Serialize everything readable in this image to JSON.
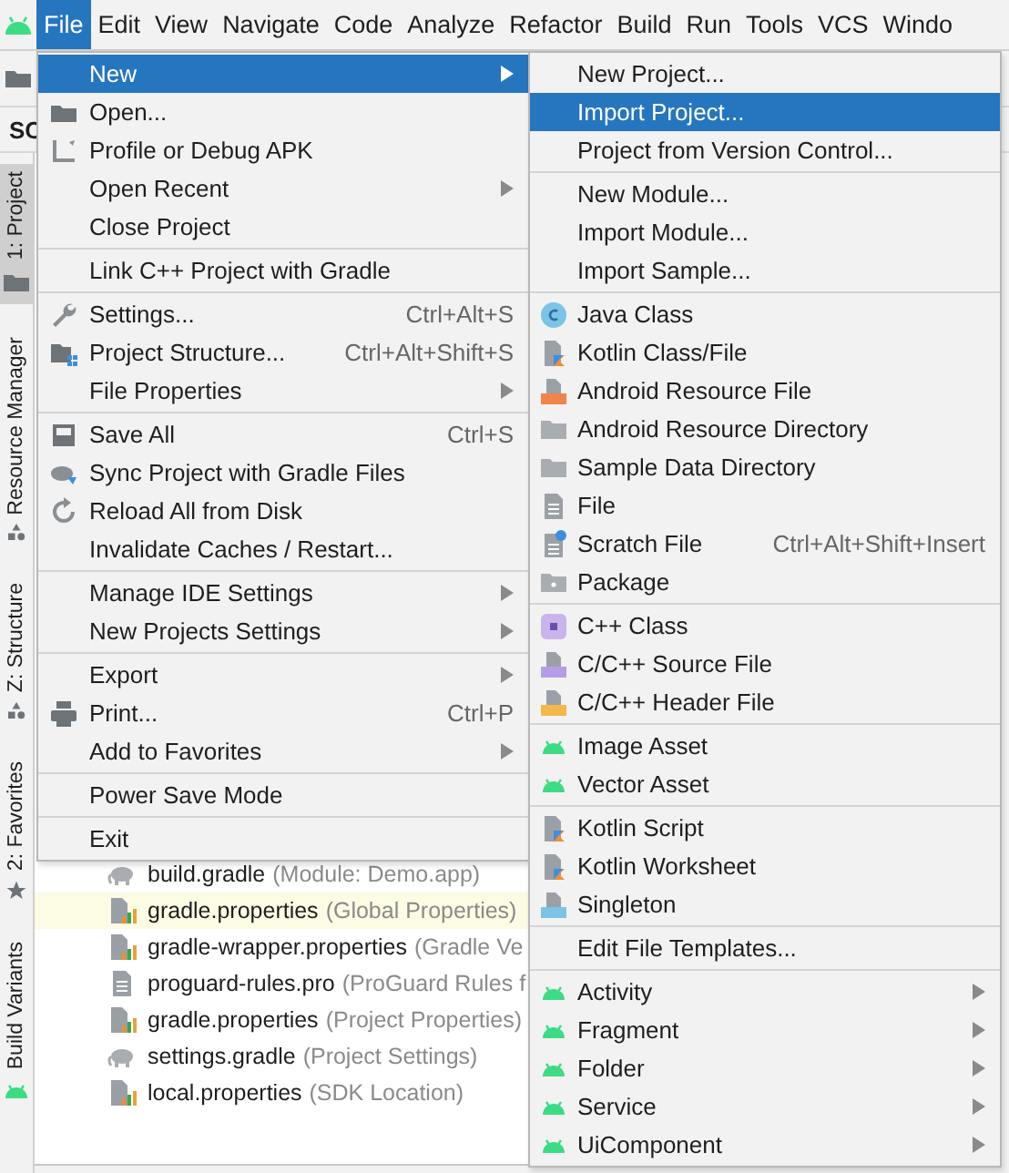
{
  "menubar": {
    "items": [
      {
        "label": "File",
        "selected": true
      },
      {
        "label": "Edit",
        "selected": false
      },
      {
        "label": "View",
        "selected": false
      },
      {
        "label": "Navigate",
        "selected": false
      },
      {
        "label": "Code",
        "selected": false
      },
      {
        "label": "Analyze",
        "selected": false
      },
      {
        "label": "Refactor",
        "selected": false
      },
      {
        "label": "Build",
        "selected": false
      },
      {
        "label": "Run",
        "selected": false
      },
      {
        "label": "Tools",
        "selected": false
      },
      {
        "label": "VCS",
        "selected": false
      },
      {
        "label": "Windo",
        "selected": false
      }
    ]
  },
  "editor_tab": {
    "label": "SC"
  },
  "tool_strip": [
    {
      "label": "1: Project",
      "selected": true
    },
    {
      "label": "Resource Manager",
      "selected": false
    },
    {
      "label": "Z: Structure",
      "selected": false
    },
    {
      "label": "2: Favorites",
      "selected": false
    },
    {
      "label": "Build Variants",
      "selected": false
    }
  ],
  "project_tree": [
    {
      "name": "build.gradle",
      "detail": "(Module: Demo.app)",
      "selected": false,
      "kind": "gradle"
    },
    {
      "name": "gradle.properties",
      "detail": "(Global Properties)",
      "selected": true,
      "kind": "properties"
    },
    {
      "name": "gradle-wrapper.properties",
      "detail": "(Gradle Ve",
      "selected": false,
      "kind": "properties"
    },
    {
      "name": "proguard-rules.pro",
      "detail": "(ProGuard Rules f",
      "selected": false,
      "kind": "text"
    },
    {
      "name": "gradle.properties",
      "detail": "(Project Properties)",
      "selected": false,
      "kind": "properties"
    },
    {
      "name": "settings.gradle",
      "detail": "(Project Settings)",
      "selected": false,
      "kind": "gradle"
    },
    {
      "name": "local.properties",
      "detail": "(SDK Location)",
      "selected": false,
      "kind": "properties"
    }
  ],
  "file_menu": {
    "groups": [
      [
        {
          "label": "New",
          "selected": true,
          "submenu": true
        },
        {
          "label": "Open...",
          "selected": false,
          "kind": "folder"
        },
        {
          "label": "Profile or Debug APK",
          "selected": false,
          "kind": "profile"
        },
        {
          "label": "Open Recent",
          "selected": false,
          "submenu": true
        },
        {
          "label": "Close Project",
          "selected": false
        }
      ],
      [
        {
          "label": "Link C++ Project with Gradle",
          "selected": false
        }
      ],
      [
        {
          "label": "Settings...",
          "shortcut": "Ctrl+Alt+S",
          "selected": false,
          "kind": "wrench"
        },
        {
          "label": "Project Structure...",
          "shortcut": "Ctrl+Alt+Shift+S",
          "selected": false,
          "kind": "structure"
        },
        {
          "label": "File Properties",
          "selected": false,
          "submenu": true
        }
      ],
      [
        {
          "label": "Save All",
          "shortcut": "Ctrl+S",
          "selected": false,
          "kind": "save"
        },
        {
          "label": "Sync Project with Gradle Files",
          "selected": false,
          "kind": "sync"
        },
        {
          "label": "Reload All from Disk",
          "selected": false,
          "kind": "reload"
        },
        {
          "label": "Invalidate Caches / Restart...",
          "selected": false
        }
      ],
      [
        {
          "label": "Manage IDE Settings",
          "selected": false,
          "submenu": true
        },
        {
          "label": "New Projects Settings",
          "selected": false,
          "submenu": true
        }
      ],
      [
        {
          "label": "Export",
          "selected": false,
          "submenu": true
        },
        {
          "label": "Print...",
          "shortcut": "Ctrl+P",
          "selected": false,
          "kind": "print"
        },
        {
          "label": "Add to Favorites",
          "selected": false,
          "submenu": true
        }
      ],
      [
        {
          "label": "Power Save Mode",
          "selected": false
        }
      ],
      [
        {
          "label": "Exit",
          "selected": false
        }
      ]
    ]
  },
  "new_submenu": {
    "groups": [
      [
        {
          "label": "New Project...",
          "selected": false
        },
        {
          "label": "Import Project...",
          "selected": true
        },
        {
          "label": "Project from Version Control...",
          "selected": false
        }
      ],
      [
        {
          "label": "New Module...",
          "selected": false
        },
        {
          "label": "Import Module...",
          "selected": false
        },
        {
          "label": "Import Sample...",
          "selected": false
        }
      ],
      [
        {
          "label": "Java Class",
          "selected": false,
          "kind": "java"
        },
        {
          "label": "Kotlin Class/File",
          "selected": false,
          "kind": "kotlin"
        },
        {
          "label": "Android Resource File",
          "selected": false,
          "kind": "resource"
        },
        {
          "label": "Android Resource Directory",
          "selected": false,
          "kind": "dir"
        },
        {
          "label": "Sample Data Directory",
          "selected": false,
          "kind": "dir"
        },
        {
          "label": "File",
          "selected": false,
          "kind": "text"
        },
        {
          "label": "Scratch File",
          "shortcut": "Ctrl+Alt+Shift+Insert",
          "selected": false,
          "kind": "scratch"
        },
        {
          "label": "Package",
          "selected": false,
          "kind": "package"
        }
      ],
      [
        {
          "label": "C++ Class",
          "selected": false,
          "kind": "cppclass"
        },
        {
          "label": "C/C++ Source File",
          "selected": false,
          "kind": "cppsource"
        },
        {
          "label": "C/C++ Header File",
          "selected": false,
          "kind": "cppheader"
        }
      ],
      [
        {
          "label": "Image Asset",
          "selected": false,
          "kind": "android"
        },
        {
          "label": "Vector Asset",
          "selected": false,
          "kind": "android"
        }
      ],
      [
        {
          "label": "Kotlin Script",
          "selected": false,
          "kind": "kotlin"
        },
        {
          "label": "Kotlin Worksheet",
          "selected": false,
          "kind": "kotlin"
        },
        {
          "label": "Singleton",
          "selected": false,
          "kind": "singleton"
        }
      ],
      [
        {
          "label": "Edit File Templates...",
          "selected": false
        }
      ],
      [
        {
          "label": "Activity",
          "selected": false,
          "kind": "android",
          "submenu": true
        },
        {
          "label": "Fragment",
          "selected": false,
          "kind": "android",
          "submenu": true
        },
        {
          "label": "Folder",
          "selected": false,
          "kind": "android",
          "submenu": true
        },
        {
          "label": "Service",
          "selected": false,
          "kind": "android",
          "submenu": true
        },
        {
          "label": "UiComponent",
          "selected": false,
          "kind": "android",
          "submenu": true
        }
      ]
    ]
  }
}
